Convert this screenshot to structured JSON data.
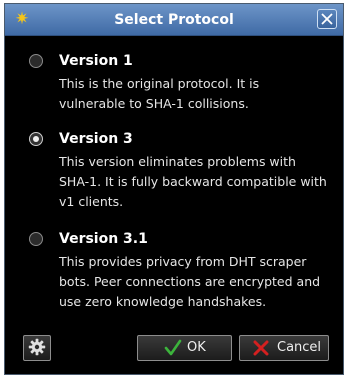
{
  "window": {
    "title": "Select Protocol",
    "title_icon": "sun-icon"
  },
  "options": [
    {
      "label": "Version 1",
      "description": "This is the original protocol.  It is vulnerable to SHA-1 collisions.",
      "selected": false
    },
    {
      "label": "Version 3",
      "description": "This version eliminates problems with SHA-1.  It is fully backward compatible with v1 clients.",
      "selected": true
    },
    {
      "label": "Version 3.1",
      "description": "This provides privacy from DHT scraper bots.  Peer connections are encrypted and use zero knowledge handshakes.",
      "selected": false
    }
  ],
  "buttons": {
    "settings_icon": "gear-icon",
    "ok_label": "OK",
    "ok_icon": "checkmark-icon",
    "cancel_label": "Cancel",
    "cancel_icon": "x-icon"
  },
  "colors": {
    "title_bar": "#4f7bb5",
    "background": "#000000",
    "ok_check": "#3cb43c",
    "cancel_x": "#d42020"
  }
}
